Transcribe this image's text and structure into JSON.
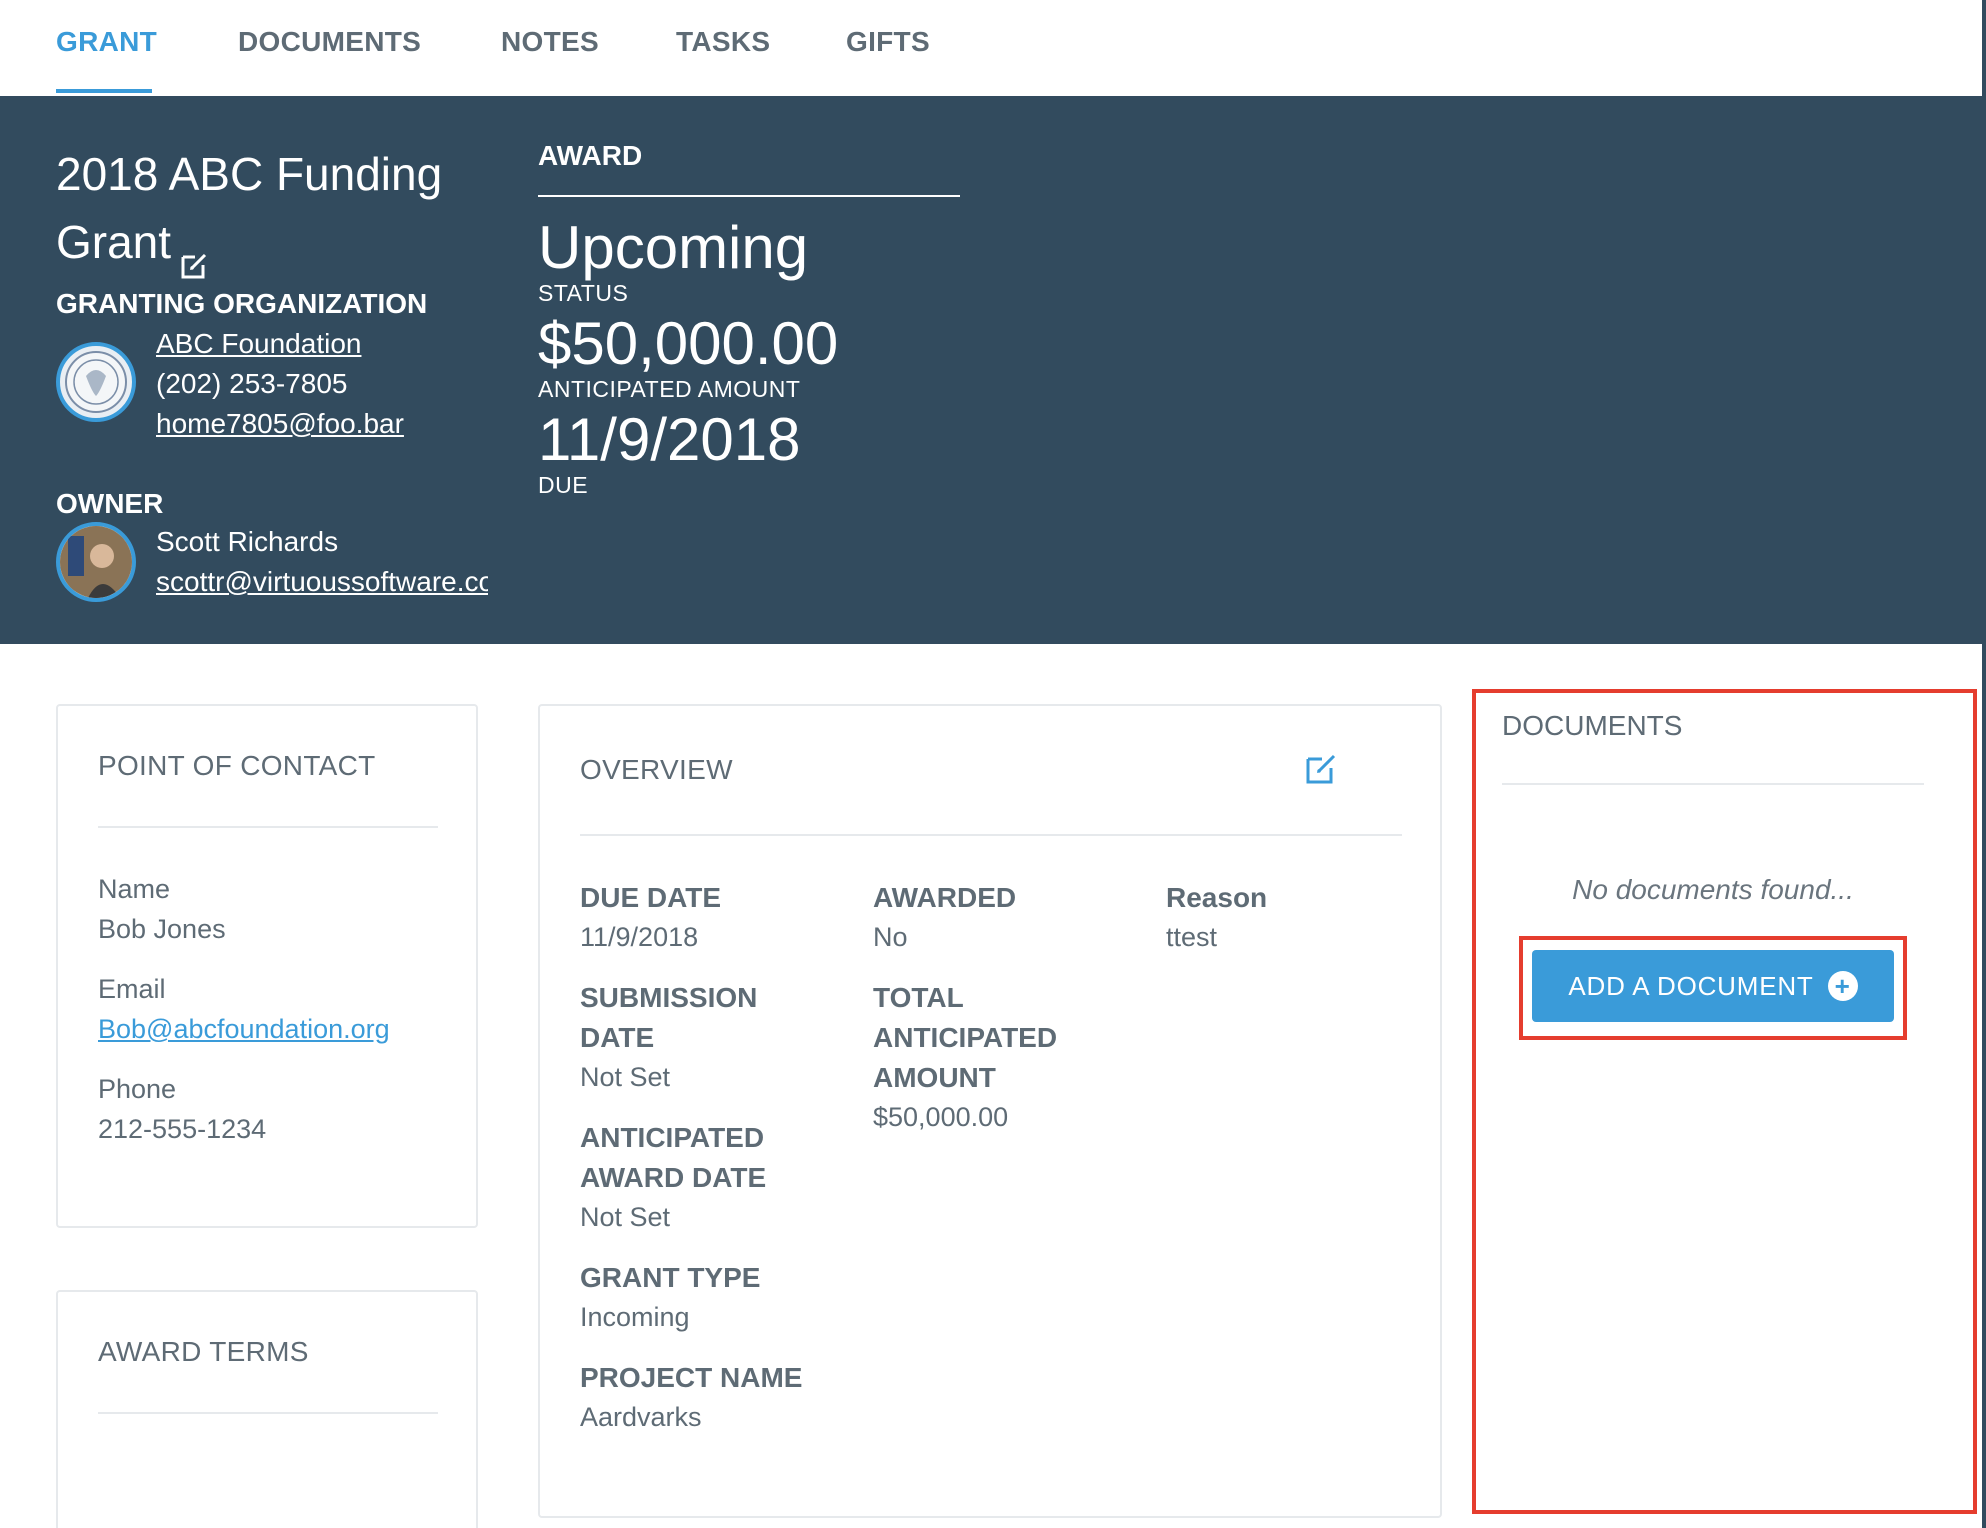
{
  "tabs": [
    {
      "label": "GRANT",
      "active": true
    },
    {
      "label": "DOCUMENTS",
      "active": false
    },
    {
      "label": "NOTES",
      "active": false
    },
    {
      "label": "TASKS",
      "active": false
    },
    {
      "label": "GIFTS",
      "active": false
    }
  ],
  "header": {
    "title_line1": "2018 ABC Funding",
    "title_line2": "Grant",
    "granting_org_label": "GRANTING ORGANIZATION",
    "org": {
      "name": "ABC Foundation",
      "phone": "(202) 253-7805",
      "email": "home7805@foo.bar"
    },
    "owner_label": "OWNER",
    "owner": {
      "name": "Scott Richards",
      "email": "scottr@virtuoussoftware.com"
    },
    "award_label": "AWARD",
    "status_value": "Upcoming",
    "status_label": "STATUS",
    "amount_value": "$50,000.00",
    "amount_label": "ANTICIPATED AMOUNT",
    "due_value": "11/9/2018",
    "due_label": "DUE"
  },
  "contact": {
    "title": "POINT OF CONTACT",
    "name_label": "Name",
    "name_value": "Bob Jones",
    "email_label": "Email",
    "email_value": "Bob@abcfoundation.org",
    "phone_label": "Phone",
    "phone_value": "212-555-1234"
  },
  "award_terms": {
    "title": "AWARD TERMS"
  },
  "overview": {
    "title": "OVERVIEW",
    "due_date_label": "DUE DATE",
    "due_date_value": "11/9/2018",
    "submission_label_1": "SUBMISSION",
    "submission_label_2": "DATE",
    "submission_value": "Not Set",
    "anticipated_award_label_1": "ANTICIPATED",
    "anticipated_award_label_2": "AWARD DATE",
    "anticipated_award_value": "Not Set",
    "grant_type_label": "GRANT TYPE",
    "grant_type_value": "Incoming",
    "project_label": "PROJECT NAME",
    "project_value": "Aardvarks",
    "awarded_label": "AWARDED",
    "awarded_value": "No",
    "total_label_1": "TOTAL",
    "total_label_2": "ANTICIPATED",
    "total_label_3": "AMOUNT",
    "total_value": "$50,000.00",
    "reason_label": "Reason",
    "reason_value": "ttest"
  },
  "documents": {
    "title": "DOCUMENTS",
    "empty_text": "No documents found...",
    "add_label": "ADD A DOCUMENT"
  },
  "colors": {
    "accent": "#3a9bd9",
    "header_bg": "#324b5e",
    "highlight": "#e53d2e"
  }
}
